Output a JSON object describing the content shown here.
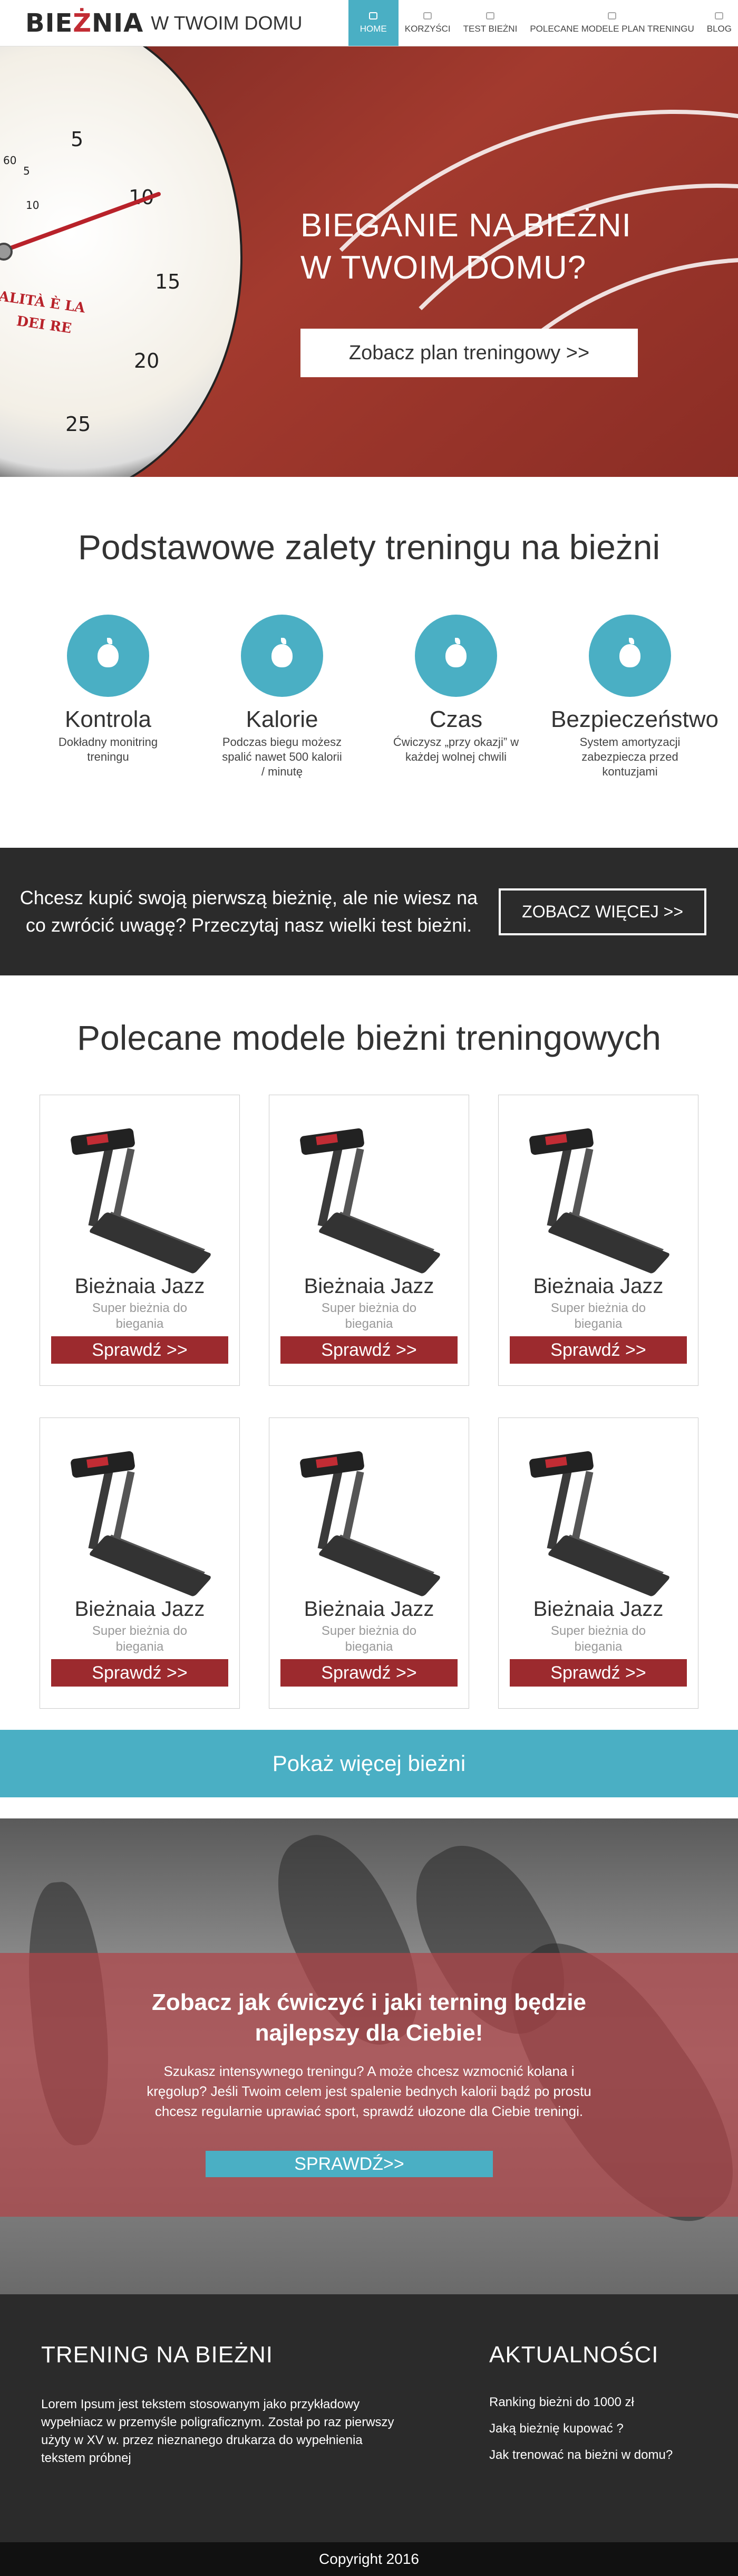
{
  "logo": {
    "brand_black": "BIE",
    "brand_red": "Ż",
    "brand_rest": "NIA",
    "tagline": "W TWOIM DOMU"
  },
  "nav": {
    "items": [
      {
        "label": "Home",
        "icon": "home-icon",
        "active": true
      },
      {
        "label": "Korzyści",
        "icon": "chat-icon"
      },
      {
        "label": "Test bieżni",
        "icon": "pencil-icon"
      },
      {
        "label": "Polecane modele plan treningu",
        "icon": "pencil-icon"
      },
      {
        "label": "Blog",
        "icon": "doc-icon"
      }
    ]
  },
  "hero": {
    "title_line1": "BIEGANIE NA BIEŻNI",
    "title_line2": "W TWOIM DOMU?",
    "button": "Zobacz plan treningowy >>",
    "stopwatch_numbers": [
      "5",
      "10",
      "15",
      "20",
      "25",
      "60",
      "5",
      "10"
    ],
    "stopwatch_text": [
      "ALITÀ È LA",
      "DEI RE"
    ]
  },
  "features": {
    "title": "Podstawowe zalety treningu na bieżni",
    "items": [
      {
        "name": "Kontrola",
        "desc": "Dokładny monitring treningu"
      },
      {
        "name": "Kalorie",
        "desc": "Podczas biegu możesz spalić nawet 500 kalorii / minutę"
      },
      {
        "name": "Czas",
        "desc": "Ćwiczysz „przy okazji” w każdej wolnej chwili"
      },
      {
        "name": "Bezpieczeństwo",
        "desc": "System amortyzacji zabezpiecza przed kontuzjami"
      }
    ]
  },
  "cta": {
    "text": "Chcesz kupić swoją pierwszą bieżnię, ale nie wiesz na co zwrócić uwagę? Przeczytaj nasz wielki test bieżni.",
    "button": "ZOBACZ WIĘCEJ >>"
  },
  "products": {
    "title": "Polecane modele bieżni treningowych",
    "items": [
      {
        "name": "Bieżnaia Jazz",
        "sub": "Super bieżnia do biegania",
        "button": "Sprawdź >>"
      },
      {
        "name": "Bieżnaia Jazz",
        "sub": "Super bieżnia do biegania",
        "button": "Sprawdź >>"
      },
      {
        "name": "Bieżnaia Jazz",
        "sub": "Super bieżnia do biegania",
        "button": "Sprawdź >>"
      },
      {
        "name": "Bieżnaia Jazz",
        "sub": "Super bieżnia do biegania",
        "button": "Sprawdź >>"
      },
      {
        "name": "Bieżnaia Jazz",
        "sub": "Super bieżnia do biegania",
        "button": "Sprawdź >>"
      },
      {
        "name": "Bieżnaia Jazz",
        "sub": "Super bieżnia do biegania",
        "button": "Sprawdź >>"
      }
    ],
    "more": "Pokaż więcej bieżni"
  },
  "training": {
    "title_line1": "Zobacz jak ćwiczyć i jaki terning będzie",
    "title_line2": "najlepszy dla Ciebie!",
    "text": "Szukasz intensywnego treningu? A może chcesz wzmocnić kolana i kręgolup? Jeśli Twoim celem jest spalenie bednych kalorii bądź po prostu chcesz regularnie uprawiać sport, sprawdź ułozone dla Ciebie treningi.",
    "button": "SPRAWDŹ>>"
  },
  "footer": {
    "left_title": "TRENING NA BIEŻNI",
    "left_text": "Lorem Ipsum jest tekstem stosowanym jako przykładowy wypełniacz w przemyśle poligraficznym. Został po raz pierwszy użyty w XV w. przez nieznanego drukarza do wypełnienia tekstem próbnej",
    "right_title": "AKTUALNOŚCI",
    "news": [
      "Ranking bieżni do 1000 zł",
      "Jaką bieżnię kupować ?",
      "Jak trenować na bieżni w domu?"
    ],
    "copyright": "Copyright 2016"
  },
  "colors": {
    "accent": "#4aafc4",
    "brand_red": "#c22c34",
    "button_red": "#9c2a2e",
    "dark": "#2b2b2b"
  }
}
